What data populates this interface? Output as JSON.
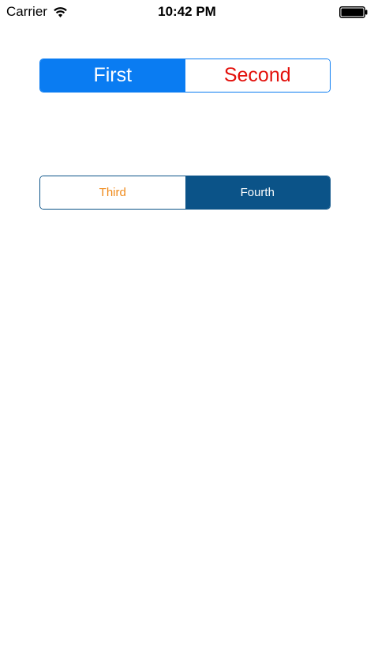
{
  "status_bar": {
    "carrier": "Carrier",
    "time": "10:42 PM",
    "wifi_icon": "wifi-icon",
    "battery_icon": "battery-icon"
  },
  "segment_control_1": {
    "selected_index": 0,
    "tint_color": "#0a7cf2",
    "items": [
      {
        "label": "First",
        "color": "#ffffff"
      },
      {
        "label": "Second",
        "color": "#e3100b"
      }
    ]
  },
  "segment_control_2": {
    "selected_index": 1,
    "tint_color": "#0b5388",
    "items": [
      {
        "label": "Third",
        "color": "#ef8a1a"
      },
      {
        "label": "Fourth",
        "color": "#ffffff"
      }
    ]
  }
}
